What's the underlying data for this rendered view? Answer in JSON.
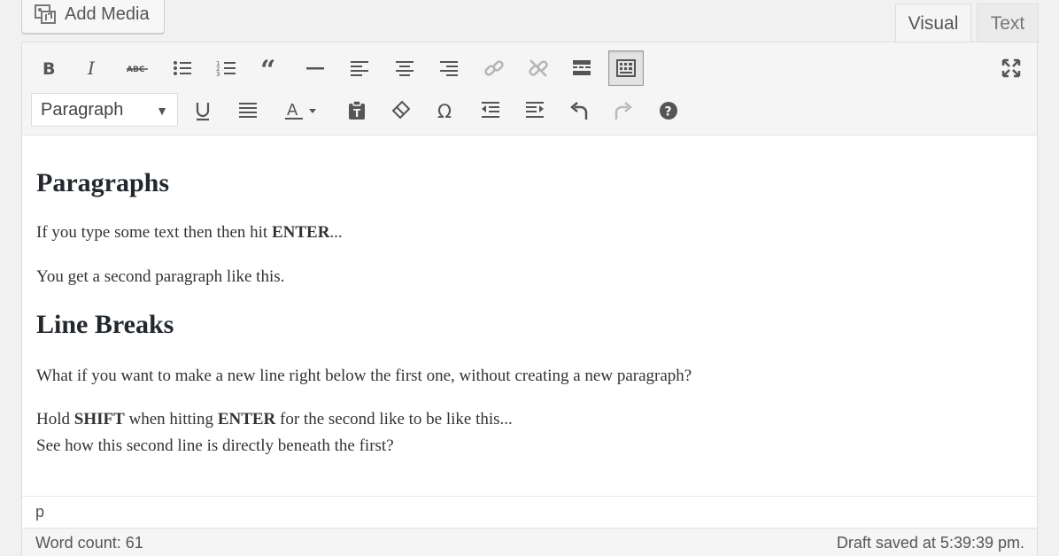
{
  "media": {
    "add_media_label": "Add Media"
  },
  "tabs": {
    "visual": "Visual",
    "text": "Text"
  },
  "toolbar": {
    "format_select": "Paragraph",
    "row1": [
      "bold-icon",
      "italic-icon",
      "strikethrough-icon",
      "bulleted-list-icon",
      "numbered-list-icon",
      "blockquote-icon",
      "horizontal-line-icon",
      "align-left-icon",
      "align-center-icon",
      "align-right-icon",
      "insert-link-icon",
      "remove-link-icon",
      "read-more-icon",
      "toolbar-toggle-icon",
      "fullscreen-icon"
    ],
    "row2": [
      "underline-icon",
      "justify-icon",
      "text-color-icon",
      "paste-as-text-icon",
      "clear-formatting-icon",
      "special-character-icon",
      "decrease-indent-icon",
      "increase-indent-icon",
      "undo-icon",
      "redo-icon",
      "help-icon"
    ]
  },
  "content": {
    "heading1": "Paragraphs",
    "p1_pre": "If you type some text then then hit ",
    "p1_bold": "ENTER",
    "p1_post": "...",
    "p2": "You get a second paragraph like this.",
    "heading2": "Line Breaks",
    "p3": "What if you want to make a new line right below the first one, without creating a new paragraph?",
    "p4_a": "Hold ",
    "p4_b": "SHIFT",
    "p4_c": " when hitting ",
    "p4_d": "ENTER",
    "p4_e": " for the second like to be like this...",
    "p4_line2": "See how this second line is directly beneath the first?"
  },
  "path": "p",
  "status": {
    "word_count": "Word count: 61",
    "draft_saved": "Draft saved at 5:39:39 pm."
  }
}
